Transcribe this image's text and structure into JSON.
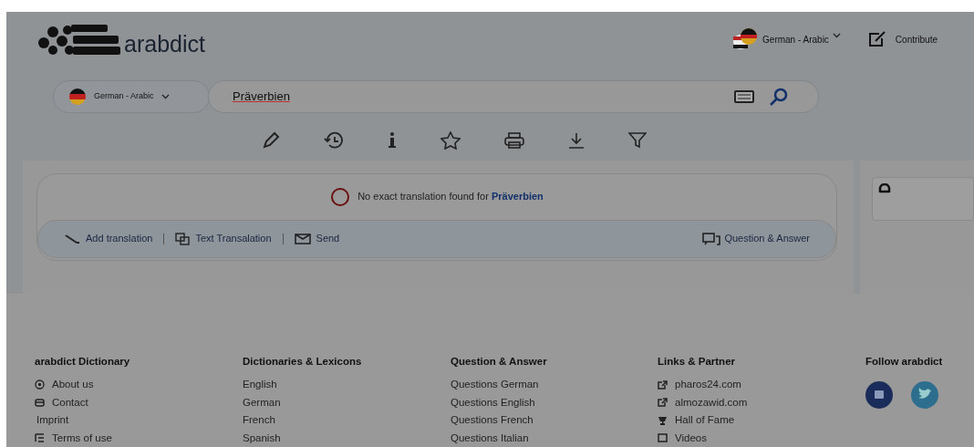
{
  "header": {
    "logo_text": "arabdict",
    "language_switch": "German - Arabic",
    "contribute": "Contribute"
  },
  "search": {
    "dictionary": "German - Arabic",
    "value": "Präverbien"
  },
  "result": {
    "message": "No exact translation found for",
    "query": "Präverbien",
    "actions": [
      "Add translation",
      "Text Transalation",
      "Send"
    ],
    "question_answer": "Question & Answer"
  },
  "footer": {
    "columns": [
      {
        "title": "arabdict Dictionary",
        "items": [
          "About us",
          "Contact",
          "Imprint",
          "Terms of use"
        ]
      },
      {
        "title": "Dictionaries & Lexicons",
        "items": [
          "English",
          "German",
          "French",
          "Spanish"
        ]
      },
      {
        "title": "Question & Answer",
        "items": [
          "Questions German",
          "Questions English",
          "Questions French",
          "Questions Italian"
        ]
      },
      {
        "title": "Links & Partner",
        "items": [
          "pharos24.com",
          "almozawid.com",
          "Hall of Fame",
          "Videos"
        ]
      },
      {
        "title": "Follow arabdict"
      }
    ]
  }
}
